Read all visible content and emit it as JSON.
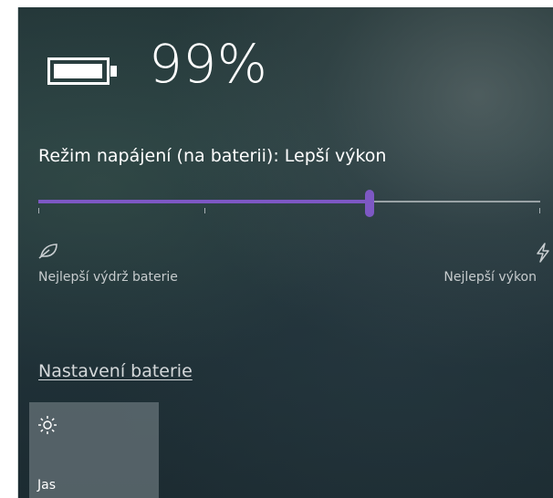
{
  "battery": {
    "percent_text": "99%",
    "level": 0.99,
    "icon": "battery-icon"
  },
  "power_mode": {
    "label": "Režim napájení (na baterii): Lepší výkon",
    "slider_level": 0.66,
    "accent_color": "#7d58c4",
    "left_icon": "leaf-icon",
    "right_icon": "lightning-icon",
    "left_label": "Nejlepší výdrž baterie",
    "right_label": "Nejlepší výkon"
  },
  "links": {
    "battery_settings": "Nastavení baterie"
  },
  "quick_actions": [
    {
      "label": "Jas",
      "icon": "brightness-icon"
    }
  ]
}
